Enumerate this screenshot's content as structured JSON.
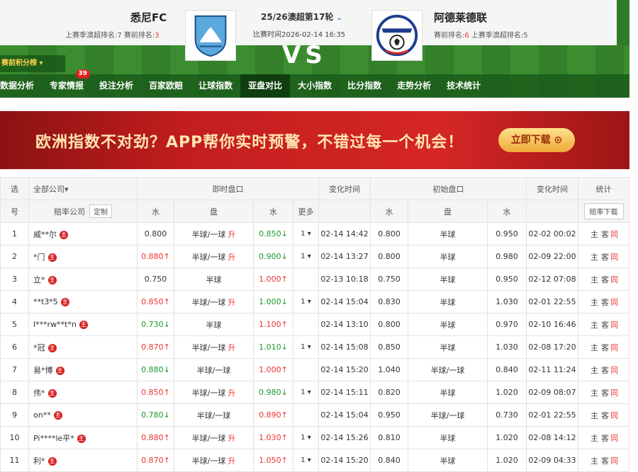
{
  "header": {
    "home_name": "悉尼FC",
    "away_name": "阿德莱德联",
    "home_stat_prefix": "上赛季澳超排名:7  赛前排名:",
    "home_rank": "3",
    "away_stat_prefix": "赛前排名:",
    "away_rank": "6",
    "away_stat_suffix": "  上赛季澳超排名:5",
    "round": "25/26澳超第17轮",
    "match_time": "比赛时间2026-02-14 16:35",
    "vs": "VS",
    "standing_label": "赛前积分榜"
  },
  "nav": [
    {
      "label": "数据分析"
    },
    {
      "label": "专家情报",
      "badge": "39"
    },
    {
      "label": "投注分析"
    },
    {
      "label": "百家欧赔"
    },
    {
      "label": "让球指数"
    },
    {
      "label": "亚盘对比",
      "active": true
    },
    {
      "label": "大小指数"
    },
    {
      "label": "比分指数"
    },
    {
      "label": "走势分析"
    },
    {
      "label": "技术统计"
    }
  ],
  "banner": {
    "text": "欧洲指数不对劲？APP帮你实时预警，不错过每一个机会！",
    "button": "立即下载 ⊙"
  },
  "table": {
    "h1": [
      "选",
      "全部公司",
      "即时盘口",
      "变化时间",
      "初始盘口",
      "变化时间",
      "统计"
    ],
    "h2": [
      "号",
      "赔率公司",
      "定制",
      "水",
      "盘",
      "水",
      "更多",
      "水",
      "盘",
      "水",
      "赔率下载"
    ],
    "tag": "主",
    "stat": [
      "主",
      "客",
      "同"
    ],
    "rows": [
      {
        "n": "1",
        "c": "威**尔",
        "w1": "0.800",
        "p": "半球/一球",
        "chg": "升",
        "w2": "0.850",
        "d2": "↓",
        "m": "1",
        "t": "02-14 14:42",
        "iw1": "0.800",
        "ip": "半球",
        "iw2": "0.950",
        "it": "02-02 00:02"
      },
      {
        "n": "2",
        "c": "*门",
        "w1": "0.880",
        "d1": "↑",
        "p": "半球/一球",
        "chg": "升",
        "w2": "0.900",
        "d2": "↓",
        "m": "1",
        "t": "02-14 13:27",
        "iw1": "0.800",
        "ip": "半球",
        "iw2": "0.980",
        "it": "02-09 22:00"
      },
      {
        "n": "3",
        "c": "立*",
        "w1": "0.750",
        "p": "半球",
        "w2": "1.000",
        "d2": "↑",
        "t": "02-13 10:18",
        "iw1": "0.750",
        "ip": "半球",
        "iw2": "0.950",
        "it": "02-12 07:08"
      },
      {
        "n": "4",
        "c": "**t3*5",
        "w1": "0.850",
        "d1": "↑",
        "p": "半球/一球",
        "chg": "升",
        "w2": "1.000",
        "d2": "↓",
        "m": "1",
        "t": "02-14 15:04",
        "iw1": "0.830",
        "ip": "半球",
        "iw2": "1.030",
        "it": "02-01 22:55"
      },
      {
        "n": "5",
        "c": "l***rw**t*n",
        "w1": "0.730",
        "d1": "↓",
        "p": "半球",
        "w2": "1.100",
        "d2": "↑",
        "t": "02-14 13:10",
        "iw1": "0.800",
        "ip": "半球",
        "iw2": "0.970",
        "it": "02-10 16:46"
      },
      {
        "n": "6",
        "c": "*冠",
        "w1": "0.870",
        "d1": "↑",
        "p": "半球/一球",
        "chg": "升",
        "w2": "1.010",
        "d2": "↓",
        "m": "1",
        "t": "02-14 15:08",
        "iw1": "0.850",
        "ip": "半球",
        "iw2": "1.030",
        "it": "02-08 17:20"
      },
      {
        "n": "7",
        "c": "易*博",
        "w1": "0.880",
        "d1": "↓",
        "p": "半球/一球",
        "w2": "1.000",
        "d2": "↑",
        "t": "02-14 15:20",
        "iw1": "1.040",
        "ip": "半球/一球",
        "iw2": "0.840",
        "it": "02-11 11:24"
      },
      {
        "n": "8",
        "c": "伟*",
        "w1": "0.850",
        "d1": "↑",
        "p": "半球/一球",
        "chg": "升",
        "w2": "0.980",
        "d2": "↓",
        "m": "1",
        "t": "02-14 15:11",
        "iw1": "0.820",
        "ip": "半球",
        "iw2": "1.020",
        "it": "02-09 08:07"
      },
      {
        "n": "9",
        "c": "on**",
        "w1": "0.780",
        "d1": "↓",
        "p": "半球/一球",
        "w2": "0.890",
        "d2": "↑",
        "t": "02-14 15:04",
        "iw1": "0.950",
        "ip": "半球/一球",
        "iw2": "0.730",
        "it": "02-01 22:55"
      },
      {
        "n": "10",
        "c": "Pi****le平*",
        "w1": "0.880",
        "d1": "↑",
        "p": "半球/一球",
        "chg": "升",
        "w2": "1.030",
        "d2": "↑",
        "m": "1",
        "t": "02-14 15:26",
        "iw1": "0.810",
        "ip": "半球",
        "iw2": "1.020",
        "it": "02-08 14:12"
      },
      {
        "n": "11",
        "c": "利*",
        "w1": "0.870",
        "d1": "↑",
        "p": "半球/一球",
        "chg": "升",
        "w2": "1.050",
        "d2": "↑",
        "m": "1",
        "t": "02-14 15:20",
        "iw1": "0.840",
        "ip": "半球",
        "iw2": "1.020",
        "it": "02-09 04:33"
      }
    ]
  }
}
